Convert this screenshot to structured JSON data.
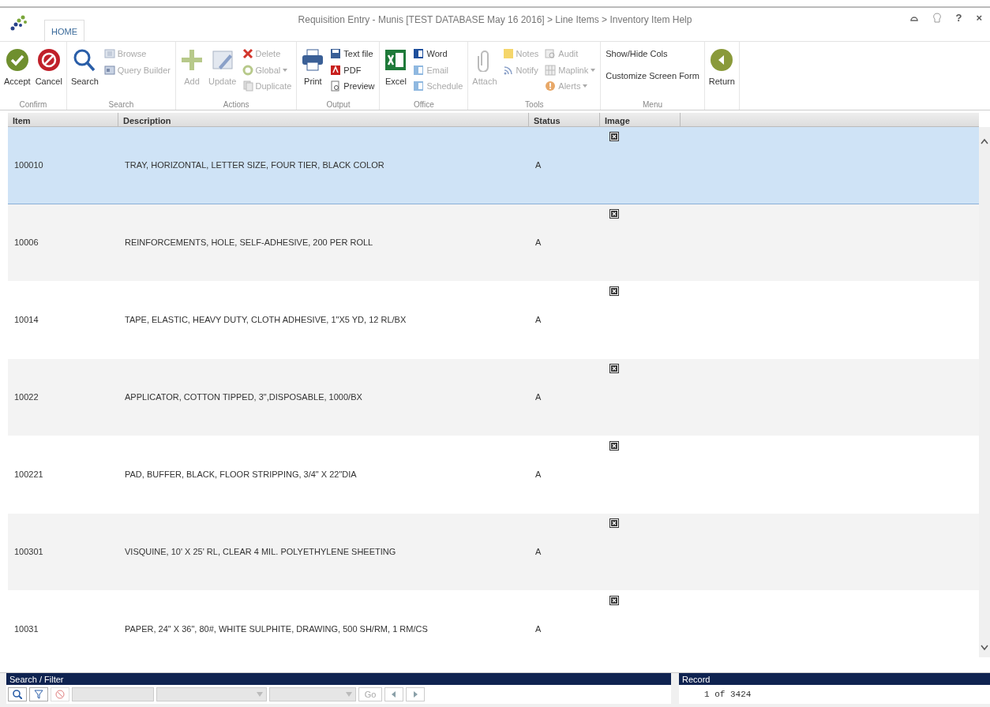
{
  "window": {
    "title": "Requisition Entry - Munis [TEST DATABASE May 16 2016] > Line Items > Inventory Item Help",
    "controls": [
      "?",
      "×"
    ]
  },
  "tabs": [
    {
      "label": "HOME",
      "selected": true
    }
  ],
  "ribbon_groups": [
    {
      "label": "Confirm",
      "columns": [
        [
          {
            "label": "Accept",
            "kind": "large",
            "disabled": false
          }
        ],
        [
          {
            "label": "Cancel",
            "kind": "large",
            "disabled": false
          }
        ]
      ]
    },
    {
      "label": "Search",
      "columns": [
        [
          {
            "label": "Search",
            "kind": "large",
            "disabled": false
          }
        ],
        [
          {
            "label": "Browse",
            "kind": "small",
            "disabled": true
          },
          {
            "label": "Query Builder",
            "kind": "small",
            "disabled": true
          }
        ]
      ]
    },
    {
      "label": "Actions",
      "columns": [
        [
          {
            "label": "Add",
            "kind": "large",
            "disabled": true
          }
        ],
        [
          {
            "label": "Update",
            "kind": "large",
            "disabled": true
          }
        ],
        [
          {
            "label": "Delete",
            "kind": "small",
            "disabled": true
          },
          {
            "label": "Global",
            "kind": "small",
            "disabled": true,
            "dropdown": true
          },
          {
            "label": "Duplicate",
            "kind": "small",
            "disabled": true
          }
        ]
      ]
    },
    {
      "label": "Output",
      "columns": [
        [
          {
            "label": "Print",
            "kind": "large",
            "disabled": false
          }
        ],
        [
          {
            "label": "Text file",
            "kind": "small",
            "disabled": false
          },
          {
            "label": "PDF",
            "kind": "small",
            "disabled": false
          },
          {
            "label": "Preview",
            "kind": "small",
            "disabled": false
          }
        ]
      ]
    },
    {
      "label": "Office",
      "columns": [
        [
          {
            "label": "Excel",
            "kind": "large",
            "disabled": false
          }
        ],
        [
          {
            "label": "Word",
            "kind": "small",
            "disabled": false
          },
          {
            "label": "Email",
            "kind": "small",
            "disabled": true
          },
          {
            "label": "Schedule",
            "kind": "small",
            "disabled": true
          }
        ]
      ]
    },
    {
      "label": "Tools",
      "columns": [
        [
          {
            "label": "Attach",
            "kind": "large",
            "disabled": true
          }
        ],
        [
          {
            "label": "Notes",
            "kind": "small",
            "disabled": true
          },
          {
            "label": "Notify",
            "kind": "small",
            "disabled": true
          }
        ],
        [
          {
            "label": "Audit",
            "kind": "small",
            "disabled": true
          },
          {
            "label": "Maplink",
            "kind": "small",
            "disabled": true,
            "dropdown": true
          },
          {
            "label": "Alerts",
            "kind": "small",
            "disabled": true,
            "dropdown": true
          }
        ]
      ]
    },
    {
      "label": "Menu",
      "columns": [
        [
          {
            "label": "Show/Hide Cols",
            "kind": "text",
            "disabled": false
          },
          {
            "label": "Customize Screen Form",
            "kind": "text",
            "disabled": false
          }
        ]
      ]
    },
    {
      "columns": [
        [
          {
            "label": "Return",
            "kind": "large",
            "disabled": false
          }
        ]
      ]
    }
  ],
  "table": {
    "columns": [
      "Item",
      "Description",
      "Status",
      "Image"
    ],
    "rows": [
      {
        "item": "100010",
        "description": "TRAY, HORIZONTAL, LETTER SIZE, FOUR TIER, BLACK COLOR",
        "status": "A",
        "selected": true
      },
      {
        "item": "10006",
        "description": "REINFORCEMENTS, HOLE, SELF-ADHESIVE, 200 PER ROLL",
        "status": "A",
        "selected": false
      },
      {
        "item": "10014",
        "description": "TAPE, ELASTIC, HEAVY DUTY, CLOTH ADHESIVE, 1\"X5 YD, 12 RL/BX",
        "status": "A",
        "selected": false
      },
      {
        "item": "10022",
        "description": "APPLICATOR, COTTON TIPPED, 3\",DISPOSABLE, 1000/BX",
        "status": "A",
        "selected": false
      },
      {
        "item": "100221",
        "description": "PAD, BUFFER, BLACK, FLOOR STRIPPING, 3/4\" X 22\"DIA",
        "status": "A",
        "selected": false
      },
      {
        "item": "100301",
        "description": "VISQUINE, 10' X 25' RL, CLEAR 4 MIL. POLYETHYLENE SHEETING",
        "status": "A",
        "selected": false
      },
      {
        "item": "10031",
        "description": "PAPER, 24\" X 36\", 80#, WHITE SULPHITE, DRAWING, 500 SH/RM, 1 RM/CS",
        "status": "A",
        "selected": false
      }
    ]
  },
  "search_filter": {
    "title": "Search / Filter",
    "go_label": "Go"
  },
  "record": {
    "title": "Record",
    "value": "1 of 3424"
  }
}
